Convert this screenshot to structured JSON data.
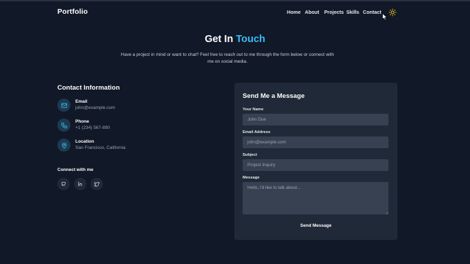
{
  "nav": {
    "brand": "Portfolio",
    "links": [
      "Home",
      "About",
      "Projects",
      "Skills",
      "Contact"
    ]
  },
  "hero": {
    "title_main": "Get In",
    "title_accent": "Touch",
    "subtitle": "Have a project in mind or want to chat? Feel free to reach out to me through the form below or connect with me on social media."
  },
  "contact": {
    "title": "Contact Information",
    "items": [
      {
        "label": "Email",
        "value": "john@example.com",
        "icon": "mail-icon"
      },
      {
        "label": "Phone",
        "value": "+1 (234) 567-890",
        "icon": "phone-icon"
      },
      {
        "label": "Location",
        "value": "San Francisco, California",
        "icon": "location-pin-icon"
      }
    ],
    "connect_title": "Connect with me",
    "socials": [
      "github-icon",
      "linkedin-icon",
      "twitter-icon"
    ]
  },
  "form": {
    "title": "Send Me a Message",
    "name_label": "Your Name",
    "name_placeholder": "John Doe",
    "email_label": "Email Address",
    "email_placeholder": "john@example.com",
    "subject_label": "Subject",
    "subject_placeholder": "Project Inquiry",
    "message_label": "Message",
    "message_placeholder": "Hello, I'd like to talk about...",
    "submit": "Send Message"
  },
  "colors": {
    "background": "#111827",
    "card": "#1f2937",
    "input": "#374151",
    "accent": "#38bdf8",
    "theme_icon": "#facc15"
  }
}
